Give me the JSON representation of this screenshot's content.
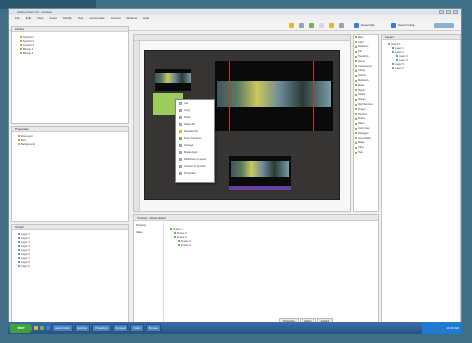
{
  "window": {
    "title": "Adobe Flash CS - Untitled",
    "menu": [
      "File",
      "Edit",
      "View",
      "Insert",
      "Modify",
      "Text",
      "Commands",
      "Control",
      "Window",
      "Help"
    ],
    "toolbar_text_1": "Essentials",
    "toolbar_text_2": "Search Help"
  },
  "left_top_panel": {
    "title": "Library",
    "items": [
      "Symbol 1",
      "Symbol 2",
      "Symbol 3",
      "Bitmap 1",
      "Bitmap 2"
    ]
  },
  "left_mid_panel": {
    "title": "Properties",
    "items": [
      "Document",
      "Size",
      "Background"
    ]
  },
  "left_bottom_panel": {
    "title": "Output",
    "items": [
      "Layer 1",
      "Layer 2",
      "Layer 3",
      "Layer 4",
      "Layer 5",
      "Layer 6",
      "Layer 7",
      "Layer 8",
      "Layer 9"
    ]
  },
  "context_menu": {
    "items": [
      "Cut",
      "Copy",
      "Paste",
      "Select All",
      "Deselect All",
      "Free Transform",
      "Arrange",
      "Break Apart",
      "Distribute to Layers",
      "Convert to Symbol",
      "Properties"
    ]
  },
  "right_list": {
    "items": [
      "Align",
      "Color",
      "Swatches",
      "Info",
      "Transform",
      "Scene",
      "Components",
      "Library",
      "Actions",
      "Behaviors",
      "Movie",
      "History",
      "Output",
      "Strings",
      "Web Services",
      "Project",
      "Timeline",
      "Motion",
      "Filters",
      "Comp Insp",
      "Debugger",
      "Accessibility",
      "Stage",
      "Other",
      "Help"
    ]
  },
  "far_right_panel": {
    "title": "Layers",
    "items": [
      "Scene 1",
      "Layer 1",
      "Layer 2",
      "Layer 3",
      "Layer 4",
      "Layer 5",
      "Layer 6"
    ]
  },
  "bottom_panel": {
    "tabs": [
      "Timeline",
      "Motion Editor"
    ],
    "labels": [
      "Property",
      "Value"
    ],
    "rows": [
      "Frame 1",
      "Frame 2",
      "Frame 3",
      "Frame 4",
      "Frame 5"
    ]
  },
  "status_tabs": [
    "Properties",
    "Library",
    "Actions"
  ],
  "taskbar": {
    "start_label": "start",
    "tasks": [
      "Adobe Flash",
      "Explorer",
      "Photoshop",
      "Notepad",
      "Folder",
      "Browser"
    ],
    "clock": "10:42 AM"
  },
  "colors": {
    "desktop": "#3f6f86",
    "taskbar": "#2a5285",
    "start": "#3fa33a",
    "stage": "#373434"
  }
}
